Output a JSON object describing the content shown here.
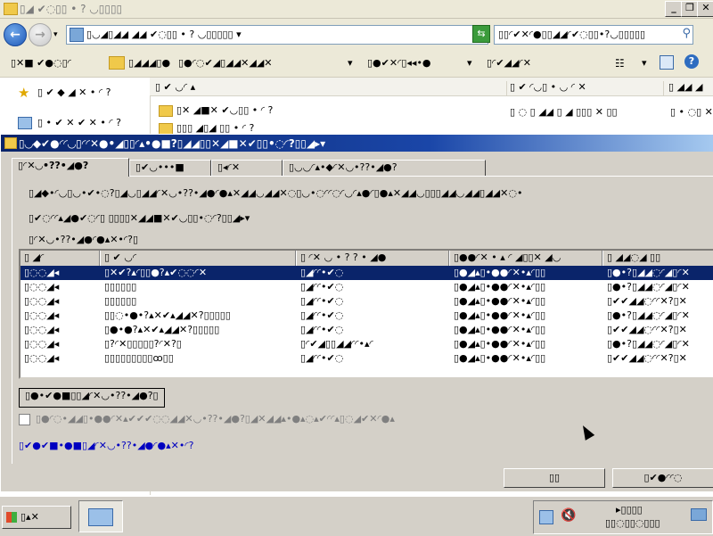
{
  "explorer": {
    "title": "▯◢ ✔◌▯▯ • ? ◡▯▯▯▯",
    "address": "▯◡◢▯◢◢ ◢◢ ✔◌▯▯ • ? ◡▯▯▯▯▯ ▾",
    "search_placeholder": "▯▯◜✔✕◜●▯▯◢◢◜✔◌▯▯•?◡▯▯▯▯▯",
    "toolbar": [
      "▯✕■ ✔●◌▯◜",
      "▯◢◢◢▯●",
      "▯●◜◌✔◢▯◢◢✕◢◢✕",
      "▯●✔✕◜▯◂◂•●",
      "▯◜✔◢◢◜✕"
    ],
    "favorites": [
      "▯ ✔ ◆ ◢ ✕ • ◜ ?",
      "▯ • ✔ ✕ ✔ ✕ • ◜ ?"
    ],
    "columns": [
      "▯ ✔ ◡◜ ▴",
      "▯ ✔ ◜◡▯ • ◡ ◜ ✕",
      "▯ ◢◢ ◢"
    ],
    "files": [
      {
        "name": "▯✕ ◢■✕ ✔◡▯▯ • ◜ ?",
        "date": "▯ ◌ ▯ ◢◢ ▯ ◢ ▯▯▯ ✕ ▯▯",
        "type": "▯ • ◌▯ ✕ ?"
      },
      {
        "name": "▯▯▯ ◢▯◢ ▯▯ • ◜ ?",
        "date": "▯ ◌ ▯ ◢◢ ▯ ◢ ▯▯▯ ✕ ▯▯",
        "type": "▯ • ◌▯ ✕ ?"
      }
    ]
  },
  "dialog": {
    "title": "▯◡◆✔●◜◜◡▯◜◜✕●•◢▯▯◜▴•●■?▯◢◢▯▯✕◢■✕✔▯▯•◌◜?▯▯◢▸▾",
    "tabs": [
      "▯◜✕◡•??•◢●?",
      "▯✔◡•••■",
      "▯◂◜✕",
      "▯◡◡◜▴•◆◜✕◡•??•◢●?"
    ],
    "description1": "▯◢◆•◜◡▯◡•✔•◌?▯◢◡▯◢◢◜✕◡•??•◢●◜●▴✕◢◢◡◢◢✕◌▯◡•◌◜◜◌◜◡◜▴●◜▯●▴✕◢◢◡▯▯▯◢◢◡◢◢▯◢◢✕◌•",
    "description2": "▯✔◌◜◜▴◢●✔◌◜▯ ▯▯▯▯✕◢◢■✕✔◡▯▯•◌◜?▯▯◢▸▾",
    "list_label": "▯◜✕◡•??•◢●◜●▴✕•◜?▯",
    "grid": {
      "headers": [
        "▯ ◢◜",
        "▯ ✔ ◡◜",
        "▯ ◜✕ ◡ • ? ? • ◢●",
        "▯●●◜✕ • ▴ ◜ ◢▯▯✕ ◢◡",
        "▯ ◢◢◌◢ ▯▯"
      ],
      "rows": [
        {
          "c0": "▯◌◌◢◂",
          "c1": "▯✕✔?▴◜▯▯●?▴✔◌◌◜✕",
          "c2": "▯◢◜◜•✔◌",
          "c3": "▯●◢▴▯•●●◜✕•▴◜▯▯",
          "c4": "▯●•?▯◢◢◌◜◢▯◜✕"
        },
        {
          "c0": "▯◌◌◢◂",
          "c1": "▯▯▯▯▯▯",
          "c2": "▯◢◜◜•✔◌",
          "c3": "▯●◢▴▯•●●◜✕•▴◜▯▯",
          "c4": "▯●•?▯◢◢◌◜◢▯◜✕"
        },
        {
          "c0": "▯◌◌◢◂",
          "c1": "▯▯▯▯▯▯",
          "c2": "▯◢◜◜•✔◌",
          "c3": "▯●◢▴▯•●●◜✕•▴◜▯▯",
          "c4": "▯✔✔◢◢◌◜◜✕?▯✕"
        },
        {
          "c0": "▯◌◌◢◂",
          "c1": "▯▯◌•●•?▴✕✔▴◢◢✕?▯▯▯▯▯",
          "c2": "▯◢◜◜•✔◌",
          "c3": "▯●◢▴▯•●●◜✕•▴◜▯▯",
          "c4": "▯●•?▯◢◢◌◜◢▯◜✕"
        },
        {
          "c0": "▯◌◌◢◂",
          "c1": "▯●•●?▴✕✔▴◢◢✕?▯▯▯▯▯",
          "c2": "▯◢◜◜•✔◌",
          "c3": "▯●◢▴▯•●●◜✕•▴◜▯▯",
          "c4": "▯✔✔◢◢◌◜◜✕?▯✕"
        },
        {
          "c0": "▯◌◌◢◂",
          "c1": "▯?◜✕▯▯▯▯▯?◜✕?▯",
          "c2": "▯◜✔◢▯▯◢◢◜◜•▴◜",
          "c3": "▯●◢▴▯•●●◜✕•▴◜▯▯",
          "c4": "▯●•?▯◢◢◌◜◢▯◜✕"
        },
        {
          "c0": "▯◌◌◢◂",
          "c1": "▯▯▯▯▯▯▯▯▯ꝏ▯▯",
          "c2": "▯◢◜◜•✔◌",
          "c3": "▯●◢▴▯•●●◜✕•▴◜▯▯",
          "c4": "▯✔✔◢◢◌◜◜✕?▯✕"
        }
      ]
    },
    "apply_button": "▯●•✔●■▯▯◢◜✕◡•??•◢●?▯",
    "hint": "▯●◜◌•◢◢▯•●●◜✕▴✔✔✔◌◌◢◢✕◡•??•◢●?▯◢✕◢◢▴•●▴◌▴✔◜◜▴▯◌◢✔✕◜●▴",
    "link": "▯✔●✔■•●■▯◢◜✕◡•??•◢●◜●▴✕•◜?",
    "ok_label": "▯▯",
    "cancel_label": "▯✔●◜◜◌"
  },
  "taskbar": {
    "start_label": "▯▴✕",
    "clock_line1": "▸▯▯▯▯",
    "clock_line2": "▯▯◌▯▯◌▯▯▯"
  }
}
